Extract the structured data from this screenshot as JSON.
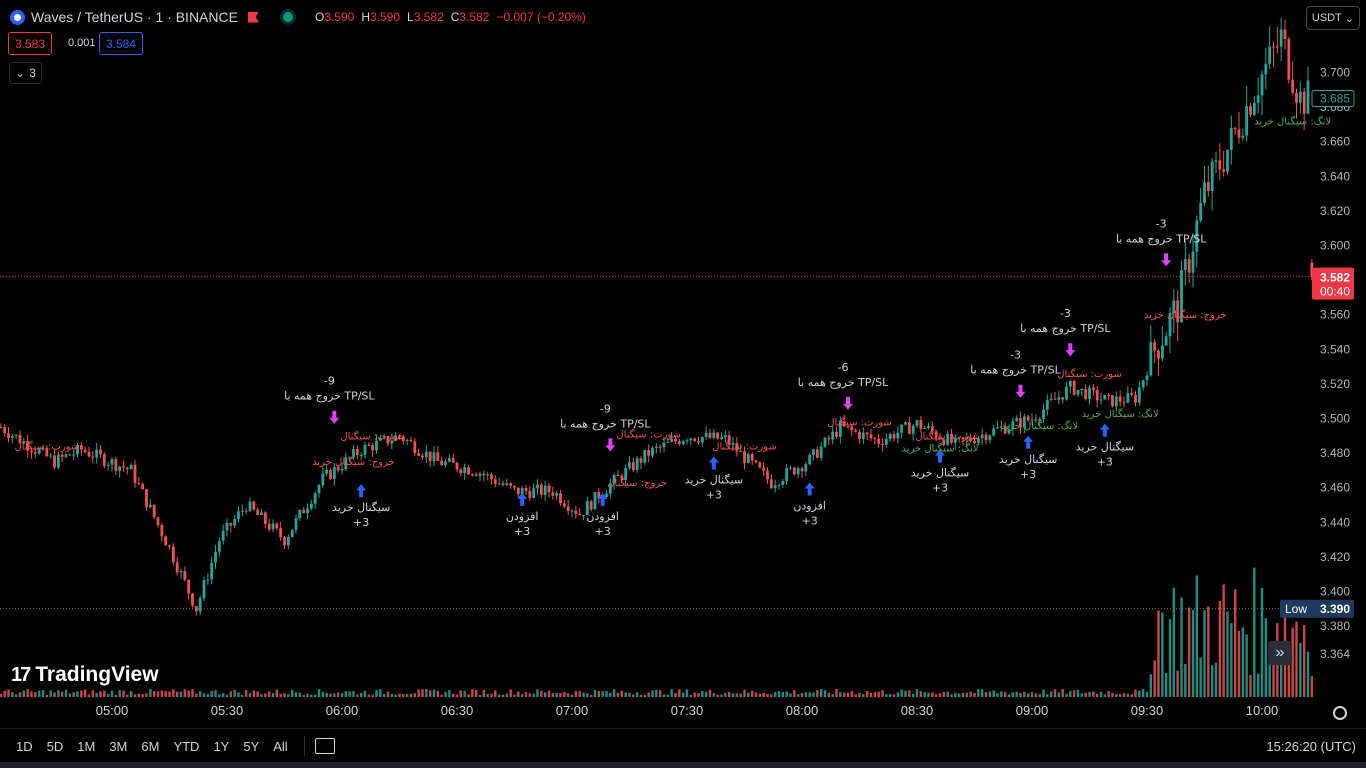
{
  "header": {
    "symbol": "Waves / TetherUS · 1 · BINANCE",
    "open_label": "O",
    "open": "3.590",
    "high_label": "H",
    "high": "3.590",
    "low_label": "L",
    "low": "3.582",
    "close_label": "C",
    "close": "3.582",
    "change": "−0.007 (−0.20%)"
  },
  "trade": {
    "sell": "3.583",
    "spread": "0.001",
    "buy": "3.584"
  },
  "indicators_count": "3",
  "currency": "USDT",
  "brand": "TradingView",
  "price_axis": {
    "last_price": "3.582",
    "countdown": "00:40",
    "indicator_price": "3.685",
    "low_label": "Low",
    "low_value": "3.390"
  },
  "time_ranges": [
    "1D",
    "5D",
    "1M",
    "3M",
    "6M",
    "YTD",
    "1Y",
    "5Y",
    "All"
  ],
  "clock": "15:26:20 (UTC)",
  "colors": {
    "up": "#26a69a",
    "down": "#ef5350",
    "long": "#2962ff",
    "exit": "#e040fb",
    "last": "#f23645"
  },
  "chart_data": {
    "type": "candlestick",
    "symbol": "WAVESUSDT",
    "interval": "1 minute",
    "y_ticks": [
      3.7,
      3.68,
      3.66,
      3.64,
      3.62,
      3.6,
      3.58,
      3.56,
      3.54,
      3.52,
      3.5,
      3.48,
      3.46,
      3.44,
      3.42,
      3.4,
      3.38,
      3.364
    ],
    "x_ticks": [
      "05:00",
      "05:30",
      "06:00",
      "06:30",
      "07:00",
      "07:30",
      "08:00",
      "08:30",
      "09:00",
      "09:30",
      "10:00"
    ],
    "ylim": [
      3.355,
      3.75
    ],
    "close_path": [
      [
        "04:31",
        3.495
      ],
      [
        "04:45",
        3.475
      ],
      [
        "04:52",
        3.482
      ],
      [
        "05:05",
        3.47
      ],
      [
        "05:15",
        3.425
      ],
      [
        "05:22",
        3.39
      ],
      [
        "05:28",
        3.43
      ],
      [
        "05:35",
        3.45
      ],
      [
        "05:45",
        3.43
      ],
      [
        "05:55",
        3.465
      ],
      [
        "06:05",
        3.482
      ],
      [
        "06:15",
        3.49
      ],
      [
        "06:25",
        3.475
      ],
      [
        "06:35",
        3.47
      ],
      [
        "06:45",
        3.458
      ],
      [
        "06:55",
        3.458
      ],
      [
        "07:02",
        3.445
      ],
      [
        "07:10",
        3.462
      ],
      [
        "07:20",
        3.48
      ],
      [
        "07:30",
        3.49
      ],
      [
        "07:40",
        3.488
      ],
      [
        "07:52",
        3.463
      ],
      [
        "08:02",
        3.476
      ],
      [
        "08:10",
        3.495
      ],
      [
        "08:20",
        3.487
      ],
      [
        "08:30",
        3.497
      ],
      [
        "08:40",
        3.485
      ],
      [
        "08:50",
        3.493
      ],
      [
        "09:00",
        3.5
      ],
      [
        "09:10",
        3.518
      ],
      [
        "09:20",
        3.51
      ],
      [
        "09:27",
        3.512
      ],
      [
        "09:32",
        3.54
      ],
      [
        "09:38",
        3.565
      ],
      [
        "09:45",
        3.63
      ],
      [
        "09:52",
        3.66
      ],
      [
        "09:58",
        3.69
      ],
      [
        "10:05",
        3.72
      ],
      [
        "10:10",
        3.685
      ],
      [
        "10:13",
        3.685
      ]
    ],
    "volume_note": "volume histogram, spike after 09:30",
    "signals": [
      {
        "time": "05:58",
        "price": 3.497,
        "kind": "exit",
        "label": "خروج همه با TP/SL",
        "qty": "-9"
      },
      {
        "time": "06:05",
        "price": 3.462,
        "kind": "long",
        "label": "سیگنال خرید",
        "qty": "+3"
      },
      {
        "time": "06:47",
        "price": 3.457,
        "kind": "long",
        "label": "افزودن",
        "qty": "+3"
      },
      {
        "time": "07:08",
        "price": 3.457,
        "kind": "long",
        "label": "افزودن",
        "qty": "+3"
      },
      {
        "time": "07:10",
        "price": 3.481,
        "kind": "exit",
        "label": "خروج همه با TP/SL",
        "qty": "-9"
      },
      {
        "time": "07:37",
        "price": 3.478,
        "kind": "long",
        "label": "سیگنال خرید",
        "qty": "+3"
      },
      {
        "time": "08:02",
        "price": 3.463,
        "kind": "long",
        "label": "افزودن",
        "qty": "+3"
      },
      {
        "time": "08:12",
        "price": 3.505,
        "kind": "exit",
        "label": "خروج همه با TP/SL",
        "qty": "-6"
      },
      {
        "time": "08:36",
        "price": 3.482,
        "kind": "long",
        "label": "سیگنال خرید",
        "qty": "+3"
      },
      {
        "time": "08:57",
        "price": 3.512,
        "kind": "exit",
        "label": "خروج همه با TP/SL",
        "qty": "-3"
      },
      {
        "time": "08:59",
        "price": 3.49,
        "kind": "long",
        "label": "سیگنال خرید",
        "qty": "+3"
      },
      {
        "time": "09:10",
        "price": 3.536,
        "kind": "exit",
        "label": "خروج همه با TP/SL",
        "qty": "-3"
      },
      {
        "time": "09:19",
        "price": 3.497,
        "kind": "long",
        "label": "سیگنال خرید",
        "qty": "+3"
      },
      {
        "time": "09:35",
        "price": 3.588,
        "kind": "exit",
        "label": "خروج همه با TP/SL",
        "qty": "-3"
      }
    ],
    "side_labels": [
      {
        "time": "04:43",
        "price": 3.482,
        "text": "شورت: سیگنال",
        "color": "red"
      },
      {
        "time": "06:08",
        "price": 3.488,
        "text": "شورت: سیگنال",
        "color": "red"
      },
      {
        "time": "06:03",
        "price": 3.473,
        "text": "خروج: سیگنال خرید",
        "color": "red"
      },
      {
        "time": "07:20",
        "price": 3.489,
        "text": "شورت: سیگنال",
        "color": "red"
      },
      {
        "time": "07:17",
        "price": 3.461,
        "text": "خروج: سیگنال",
        "color": "red"
      },
      {
        "time": "07:45",
        "price": 3.482,
        "text": "شورت: سیگنال",
        "color": "red"
      },
      {
        "time": "08:15",
        "price": 3.496,
        "text": "شورت: سیگنال",
        "color": "red"
      },
      {
        "time": "08:38",
        "price": 3.488,
        "text": "شورت: سیگنال",
        "color": "red"
      },
      {
        "time": "09:15",
        "price": 3.524,
        "text": "شورت: سیگنال",
        "color": "red"
      },
      {
        "time": "09:40",
        "price": 3.558,
        "text": "خروج: سیگنال خرید",
        "color": "red"
      },
      {
        "time": "08:36",
        "price": 3.481,
        "text": "لانگ: سیگنال خرید",
        "color": "green"
      },
      {
        "time": "09:02",
        "price": 3.494,
        "text": "لانگ: سیگنال خرید",
        "color": "green"
      },
      {
        "time": "09:23",
        "price": 3.501,
        "text": "لانگ: سیگنال خرید",
        "color": "green"
      },
      {
        "time": "10:08",
        "price": 3.67,
        "text": "لانگ: سیگنال خرید",
        "color": "green"
      }
    ]
  }
}
